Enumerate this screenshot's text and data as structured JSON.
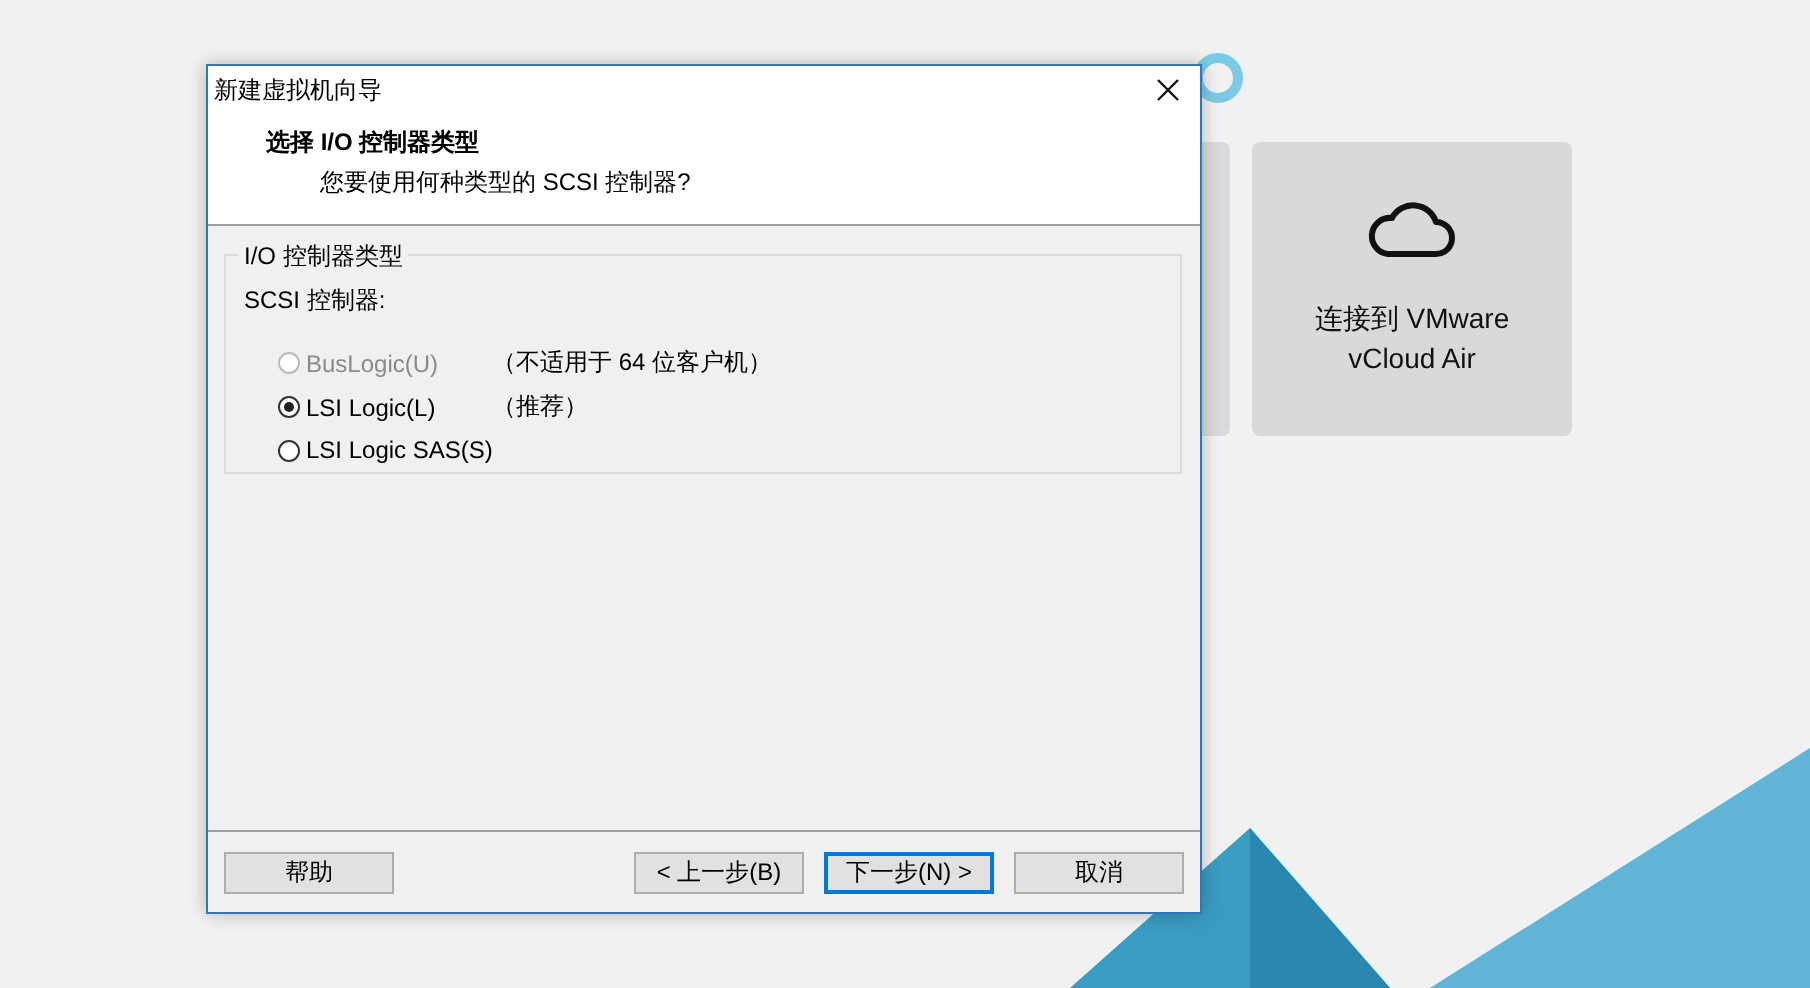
{
  "background": {
    "card": {
      "lines": [
        "连接到 VMware",
        "vCloud Air"
      ]
    }
  },
  "dialog": {
    "title": "新建虚拟机向导",
    "heading": "选择 I/O 控制器类型",
    "subheading": "您要使用何种类型的 SCSI 控制器?",
    "group": {
      "legend": "I/O 控制器类型",
      "label": "SCSI 控制器:",
      "options": [
        {
          "label": "BusLogic(U)",
          "note": "（不适用于 64 位客户机）",
          "selected": false,
          "disabled": true
        },
        {
          "label": "LSI Logic(L)",
          "note": "（推荐）",
          "selected": true,
          "disabled": false
        },
        {
          "label": "LSI Logic SAS(S)",
          "selected": false,
          "disabled": false
        }
      ]
    },
    "buttons": [
      {
        "label": "帮助",
        "kind": "help",
        "default": false
      },
      {
        "label": "< 上一步(B)",
        "kind": "nav",
        "default": false
      },
      {
        "label": "下一步(N) >",
        "kind": "nav",
        "default": true
      },
      {
        "label": "取消",
        "kind": "nav",
        "default": false
      }
    ]
  }
}
